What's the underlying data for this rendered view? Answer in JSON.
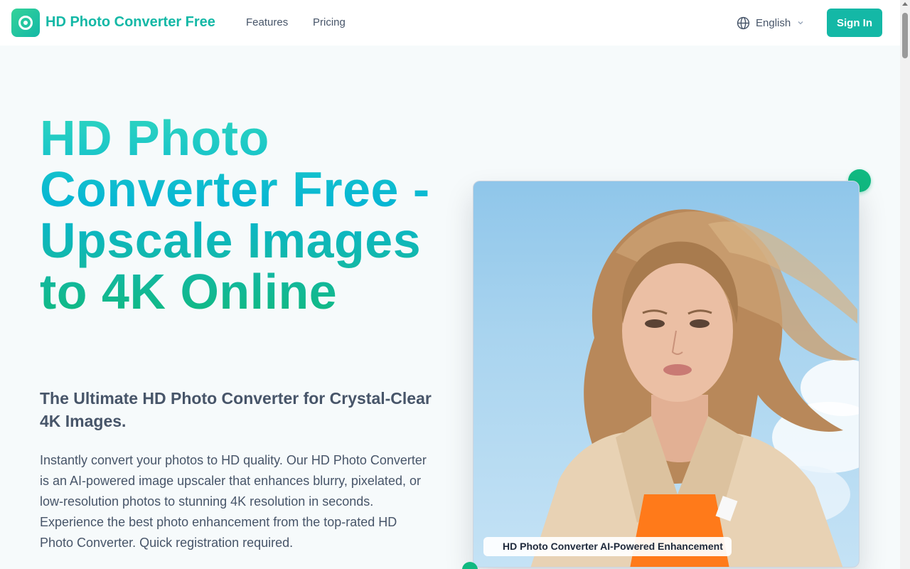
{
  "header": {
    "brand": "HD Photo Converter Free",
    "nav": [
      "Features",
      "Pricing"
    ],
    "language": "English",
    "signin_label": "Sign In"
  },
  "hero": {
    "title": "HD Photo Converter Free - Upscale Images to 4K Online",
    "subtitle": "The Ultimate HD Photo Converter for Crystal-Clear 4K Images.",
    "description": "Instantly convert your photos to HD quality. Our HD Photo Converter is an AI-powered image upscaler that enhances blurry, pixelated, or low-resolution photos to stunning 4K resolution in seconds. Experience the best photo enhancement from the top-rated HD Photo Converter. Quick registration required."
  },
  "showcase": {
    "caption": "HD Photo Converter AI-Powered Enhancement"
  },
  "icons": {
    "logo": "camera-lens-icon",
    "language": "globe-icon",
    "dropdown": "chevron-down-icon"
  },
  "colors": {
    "accent": "#14b8a6",
    "accent_green": "#10b981",
    "text": "#475569"
  }
}
